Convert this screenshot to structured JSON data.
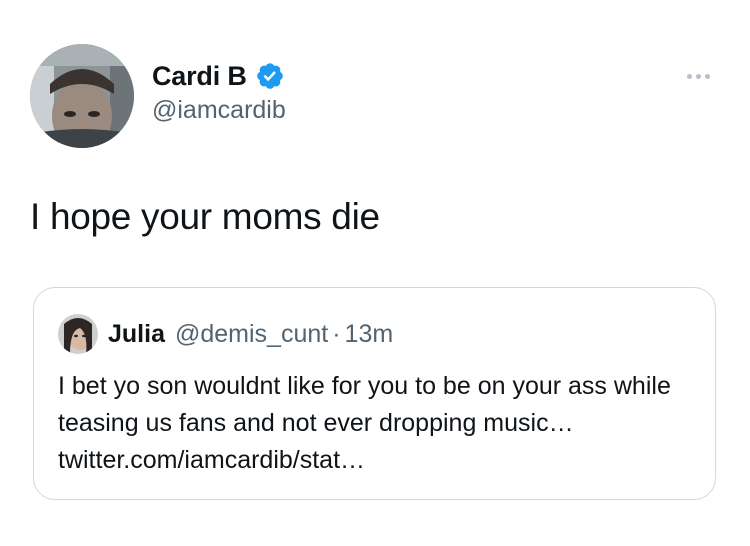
{
  "tweet": {
    "display_name": "Cardi B",
    "handle": "@iamcardib",
    "verified": true,
    "text": "I hope your moms die",
    "more_icon": "more-horizontal-icon"
  },
  "quote": {
    "display_name": "Julia",
    "handle": "@demis_cunt",
    "separator": "·",
    "time": "13m",
    "text": "I bet yo son wouldnt like for you to be on your ass while teasing us fans and not ever dropping music… twitter.com/iamcardib/stat…"
  },
  "colors": {
    "primary_text": "#0f1419",
    "secondary_text": "#536471",
    "verified_blue": "#1d9bf0",
    "border": "#cfd9de"
  }
}
